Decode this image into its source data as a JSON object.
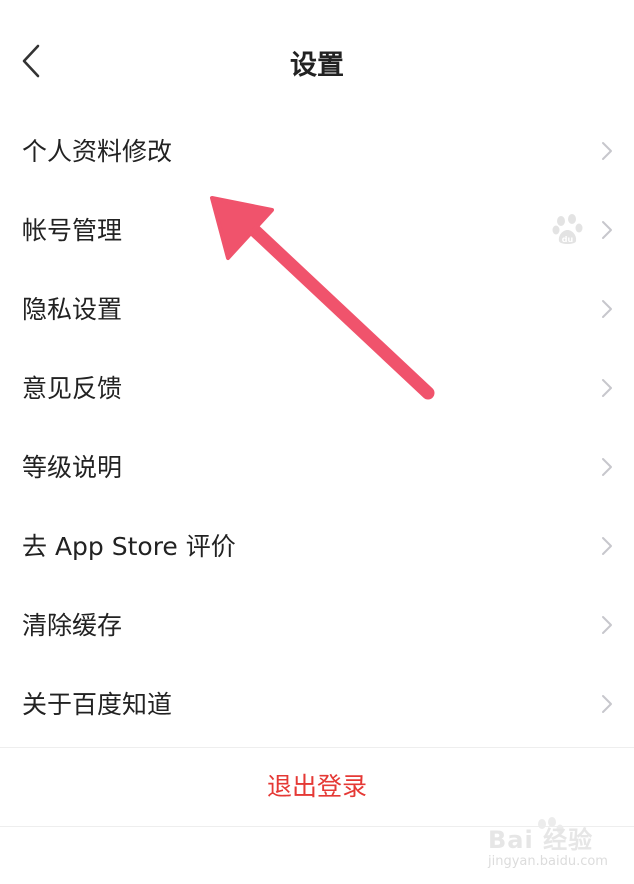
{
  "header": {
    "title": "设置",
    "back_icon": "chevron-left-icon"
  },
  "menu": {
    "items": [
      {
        "label": "个人资料修改"
      },
      {
        "label": "帐号管理",
        "badge_icon": "baidu-paw-icon"
      },
      {
        "label": "隐私设置"
      },
      {
        "label": "意见反馈"
      },
      {
        "label": "等级说明"
      },
      {
        "label": "去 App Store 评价"
      },
      {
        "label": "清除缓存"
      },
      {
        "label": "关于百度知道"
      }
    ]
  },
  "logout": {
    "label": "退出登录"
  },
  "watermark": {
    "brand": "Bai 经验",
    "url": "jingyan.baidu.com"
  },
  "colors": {
    "logout_text": "#e53935",
    "annotation_arrow": "#f0536c",
    "chevron": "#c7c7cc",
    "divider": "#eeeeee"
  }
}
